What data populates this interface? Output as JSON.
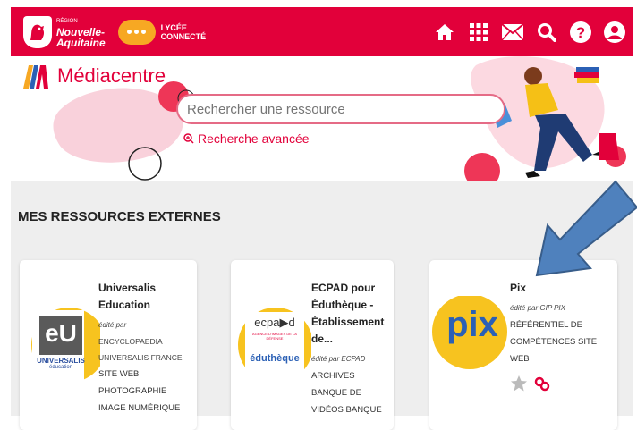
{
  "header": {
    "region_small": "RÉGION",
    "region_line1": "Nouvelle-",
    "region_line2": "Aquitaine",
    "lycee_line1": "LYCÉE",
    "lycee_line2": "CONNECTÉ",
    "colors": {
      "bar": "#e2003a",
      "bubble": "#f7a823"
    },
    "icons": [
      "home-icon",
      "apps-grid-icon",
      "mail-icon",
      "search-icon",
      "help-icon",
      "account-icon"
    ]
  },
  "hero": {
    "title": "Médiacentre",
    "search_placeholder": "Rechercher une ressource",
    "advanced_search": "Recherche avancée"
  },
  "section": {
    "title": "MES RESSOURCES EXTERNES"
  },
  "cards": [
    {
      "name": "Universalis Education",
      "editor_prefix": "édité par",
      "editor": "ENCYCLOPAEDIA UNIVERSALIS FRANCE",
      "meta": [
        "SITE WEB",
        "PHOTOGRAPHIE",
        "IMAGE NUMÉRIQUE"
      ],
      "logo_text": "eU",
      "logo_sub": "UNIVERSALIS",
      "logo_sub2": "éducation"
    },
    {
      "name": "ECPAD pour Éduthèque - Établissement de...",
      "editor_prefix": "édité par",
      "editor": "ECPAD",
      "meta": [
        "ARCHIVES",
        "BANQUE DE",
        "VIDÉOS BANQUE"
      ],
      "logo_text": "ecpa▶d",
      "logo_sub": "AGENCE D'IMAGES DE LA DÉFENSE",
      "logo_sub2": "éduthèque"
    },
    {
      "name": "Pix",
      "editor_prefix": "édité par",
      "editor": "GIP PIX",
      "meta": [
        "RÉFÉRENTIEL DE",
        "COMPÉTENCES SITE",
        "WEB"
      ],
      "logo_text": "pix"
    }
  ]
}
